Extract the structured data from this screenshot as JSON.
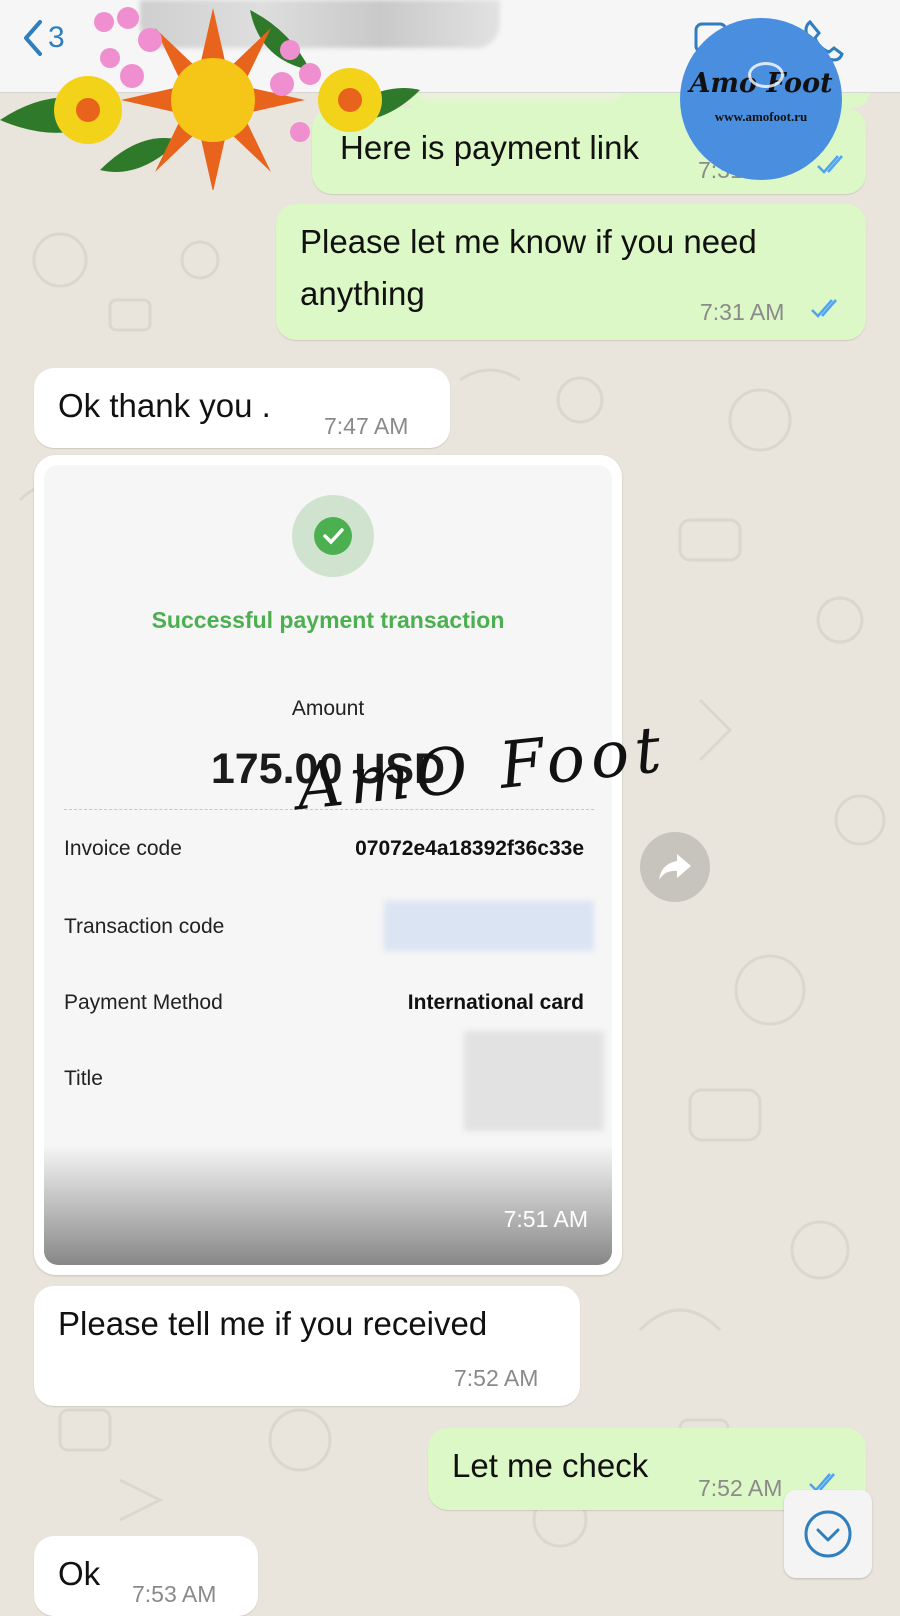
{
  "header": {
    "back_count": "3"
  },
  "logo": {
    "name": "Amo Foot",
    "url": "www.amofoot.ru"
  },
  "signature": "AmO Foot",
  "messages": [
    {
      "direction": "outgoing",
      "text": "Here is payment link",
      "time": "7:31 AM",
      "read": true
    },
    {
      "direction": "outgoing",
      "text_line1": "Please let me know if you need",
      "text_line2": "anything",
      "time": "7:31 AM",
      "read": true
    },
    {
      "direction": "incoming",
      "text": "Ok thank you .",
      "time": "7:47 AM"
    },
    {
      "direction": "incoming",
      "type": "image",
      "time": "7:51 AM"
    },
    {
      "direction": "incoming",
      "text": "Please tell me if you received",
      "time": "7:52 AM"
    },
    {
      "direction": "outgoing",
      "text": "Let me check",
      "time": "7:52 AM",
      "read": true
    },
    {
      "direction": "incoming",
      "text": "Ok",
      "time": "7:53 AM"
    }
  ],
  "receipt": {
    "title": "Successful payment transaction",
    "amount_label": "Amount",
    "amount_value": "175.00 USD",
    "rows": [
      {
        "label": "Invoice code",
        "value": "07072e4a18392f36c33e"
      },
      {
        "label": "Transaction code",
        "value": ""
      },
      {
        "label": "Payment Method",
        "value": "International card"
      },
      {
        "label": "Title",
        "value": ""
      }
    ]
  },
  "colors": {
    "outgoing_bubble": "#dcf8c6",
    "incoming_bubble": "#ffffff",
    "read_ticks": "#4fa3f7",
    "success_green": "#4caf50",
    "ios_blue": "#2f7fbf"
  },
  "icons": [
    "back-chevron-icon",
    "video-call-icon",
    "phone-icon",
    "check-icon",
    "forward-icon",
    "scroll-down-icon",
    "read-ticks-icon"
  ]
}
